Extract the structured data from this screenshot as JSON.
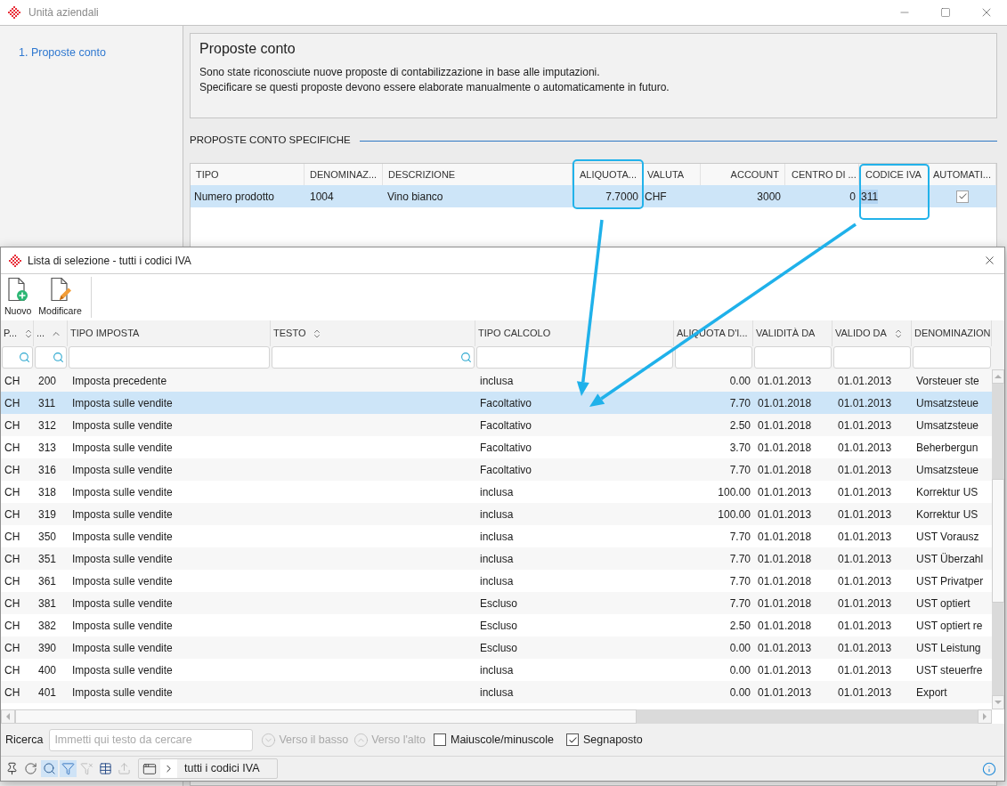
{
  "window": {
    "title": "Unità aziendali"
  },
  "sidebar": {
    "items": [
      {
        "label": "1. Proposte conto",
        "selected": true
      }
    ]
  },
  "header": {
    "title": "Proposte conto",
    "lines": [
      "Sono state riconosciute nuove proposte di contabilizzazione in base alle imputazioni.",
      "Specificare se questi proposte devono essere elaborate manualmente o automaticamente in futuro."
    ]
  },
  "proposals": {
    "title": "PROPOSTE CONTO SPECIFICHE",
    "columns": [
      "TIPO",
      "DENOMINAZ...",
      "DESCRIZIONE",
      "ALIQUOTA...",
      "VALUTA",
      "ACCOUNT",
      "CENTRO DI ...",
      "CODICE IVA",
      "AUTOMATI..."
    ],
    "rows": [
      {
        "selected": true,
        "cells": [
          {
            "kind": "text",
            "text": "Numero prodotto",
            "editing": false
          },
          {
            "kind": "text",
            "text": "1004",
            "editing": false
          },
          {
            "kind": "text",
            "text": "Vino bianco",
            "editing": false
          },
          {
            "kind": "text",
            "text": "7.7000",
            "editing": false
          },
          {
            "kind": "text",
            "text": "CHF",
            "editing": false
          },
          {
            "kind": "text",
            "text": "3000",
            "editing": false
          },
          {
            "kind": "text",
            "text": "0",
            "editing": false
          },
          {
            "kind": "text",
            "text": "311",
            "editing": true
          },
          {
            "kind": "check",
            "checked": true
          }
        ]
      }
    ]
  },
  "dialog": {
    "title": "Lista di selezione - tutti i codici IVA",
    "toolbar": [
      {
        "kind": "new",
        "label": "Nuovo"
      },
      {
        "kind": "edit",
        "label": "Modificare"
      }
    ],
    "table": {
      "columns": [
        {
          "label": "P...",
          "kind": "sortable",
          "filter_icon": true
        },
        {
          "label": "...",
          "kind": "sorted",
          "filter_icon": true
        },
        {
          "label": "TIPO IMPOSTA",
          "kind": "plain",
          "filter_icon": false
        },
        {
          "label": "TESTO",
          "kind": "sortable",
          "filter_icon": true
        },
        {
          "label": "TIPO CALCOLO",
          "kind": "plain",
          "filter_icon": false
        },
        {
          "label": "ALIQUOTA D'I...",
          "kind": "plain",
          "filter_icon": false
        },
        {
          "label": "VALIDITÀ DA",
          "kind": "plain",
          "filter_icon": false
        },
        {
          "label": "VALIDO DA",
          "kind": "sortable",
          "filter_icon": false
        },
        {
          "label": "DENOMINAZION",
          "kind": "plain",
          "filter_icon": false
        }
      ],
      "rows": [
        {
          "selected": false,
          "cells": [
            "CH",
            "200",
            "Imposta precedente",
            null,
            "inclusa",
            "0.00",
            "01.01.2013",
            "01.01.2013",
            "Vorsteuer ste"
          ]
        },
        {
          "selected": true,
          "cells": [
            "CH",
            "311",
            "Imposta sulle vendite",
            null,
            "Facoltativo",
            "7.70",
            "01.01.2018",
            "01.01.2013",
            "Umsatzsteue"
          ]
        },
        {
          "selected": false,
          "cells": [
            "CH",
            "312",
            "Imposta sulle vendite",
            null,
            "Facoltativo",
            "2.50",
            "01.01.2018",
            "01.01.2013",
            "Umsatzsteue"
          ]
        },
        {
          "selected": false,
          "cells": [
            "CH",
            "313",
            "Imposta sulle vendite",
            null,
            "Facoltativo",
            "3.70",
            "01.01.2018",
            "01.01.2013",
            "Beherbergun"
          ]
        },
        {
          "selected": false,
          "cells": [
            "CH",
            "316",
            "Imposta sulle vendite",
            null,
            "Facoltativo",
            "7.70",
            "01.01.2018",
            "01.01.2013",
            "Umsatzsteue"
          ]
        },
        {
          "selected": false,
          "cells": [
            "CH",
            "318",
            "Imposta sulle vendite",
            null,
            "inclusa",
            "100.00",
            "01.01.2013",
            "01.01.2013",
            "Korrektur US"
          ]
        },
        {
          "selected": false,
          "cells": [
            "CH",
            "319",
            "Imposta sulle vendite",
            null,
            "inclusa",
            "100.00",
            "01.01.2013",
            "01.01.2013",
            "Korrektur US"
          ]
        },
        {
          "selected": false,
          "cells": [
            "CH",
            "350",
            "Imposta sulle vendite",
            null,
            "inclusa",
            "7.70",
            "01.01.2018",
            "01.01.2013",
            "UST Vorausz"
          ]
        },
        {
          "selected": false,
          "cells": [
            "CH",
            "351",
            "Imposta sulle vendite",
            null,
            "inclusa",
            "7.70",
            "01.01.2018",
            "01.01.2013",
            "UST Überzahl"
          ]
        },
        {
          "selected": false,
          "cells": [
            "CH",
            "361",
            "Imposta sulle vendite",
            null,
            "inclusa",
            "7.70",
            "01.01.2018",
            "01.01.2013",
            "UST Privatper"
          ]
        },
        {
          "selected": false,
          "cells": [
            "CH",
            "381",
            "Imposta sulle vendite",
            null,
            "Escluso",
            "7.70",
            "01.01.2018",
            "01.01.2013",
            "UST optiert"
          ]
        },
        {
          "selected": false,
          "cells": [
            "CH",
            "382",
            "Imposta sulle vendite",
            null,
            "Escluso",
            "2.50",
            "01.01.2018",
            "01.01.2013",
            "UST optiert re"
          ]
        },
        {
          "selected": false,
          "cells": [
            "CH",
            "390",
            "Imposta sulle vendite",
            null,
            "Escluso",
            "0.00",
            "01.01.2013",
            "01.01.2013",
            "UST Leistung"
          ]
        },
        {
          "selected": false,
          "cells": [
            "CH",
            "400",
            "Imposta sulle vendite",
            null,
            "inclusa",
            "0.00",
            "01.01.2013",
            "01.01.2013",
            "UST steuerfre"
          ]
        },
        {
          "selected": false,
          "cells": [
            "CH",
            "401",
            "Imposta sulle vendite",
            null,
            "inclusa",
            "0.00",
            "01.01.2013",
            "01.01.2013",
            "Export"
          ]
        }
      ]
    },
    "search": {
      "label": "Ricerca",
      "placeholder": "Immetti qui testo da cercare",
      "nav": [
        {
          "kind": "down",
          "label": "Verso il basso",
          "disabled": true
        },
        {
          "kind": "up",
          "label": "Verso l'alto",
          "disabled": true
        }
      ],
      "options": [
        {
          "label": "Maiuscole/minuscole",
          "checked": false
        },
        {
          "label": "Segnaposto",
          "checked": true
        }
      ]
    },
    "tools": [
      {
        "kind": "pin",
        "active": false,
        "disabled": false
      },
      {
        "kind": "refresh",
        "active": false,
        "disabled": false
      },
      {
        "kind": "search",
        "active": true,
        "disabled": false
      },
      {
        "kind": "filter",
        "active": true,
        "disabled": false
      },
      {
        "kind": "clear_filter",
        "active": false,
        "disabled": true
      },
      {
        "kind": "table",
        "active": false,
        "disabled": false
      },
      {
        "kind": "export",
        "active": false,
        "disabled": true
      }
    ],
    "breadcrumb": {
      "label": "tutti i codici IVA"
    }
  }
}
